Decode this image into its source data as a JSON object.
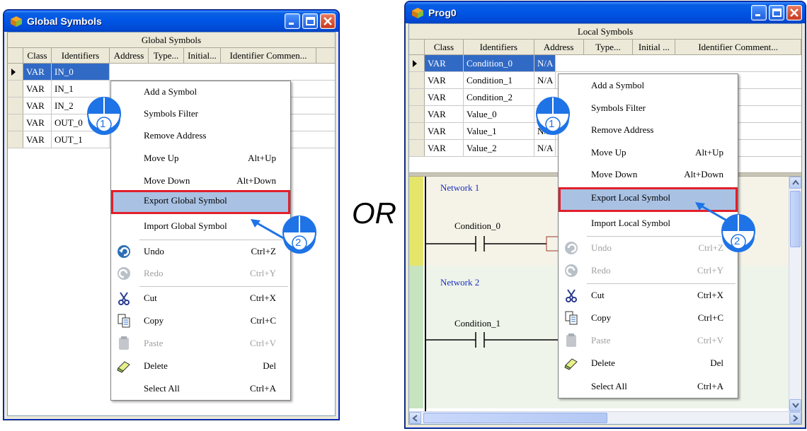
{
  "separator_text": "OR",
  "left_window": {
    "title": "Global Symbols",
    "table_caption": "Global Symbols",
    "columns": [
      "Class",
      "Identifiers",
      "Address",
      "Type...",
      "Initial...",
      "Identifier Commen..."
    ],
    "rows": [
      {
        "class": "VAR",
        "identifier": "IN_0"
      },
      {
        "class": "VAR",
        "identifier": "IN_1"
      },
      {
        "class": "VAR",
        "identifier": "IN_2"
      },
      {
        "class": "VAR",
        "identifier": "OUT_0"
      },
      {
        "class": "VAR",
        "identifier": "OUT_1"
      }
    ],
    "menu": {
      "items": [
        {
          "label": "Add a Symbol",
          "shortcut": ""
        },
        {
          "label": "Symbols Filter",
          "shortcut": ""
        },
        {
          "label": "Remove Address",
          "shortcut": ""
        },
        {
          "label": "Move Up",
          "shortcut": "Alt+Up"
        },
        {
          "label": "Move Down",
          "shortcut": "Alt+Down"
        },
        {
          "label": "Export Global Symbol",
          "shortcut": ""
        },
        {
          "label": "Import Global Symbol",
          "shortcut": ""
        },
        {
          "label": "Undo",
          "shortcut": "Ctrl+Z"
        },
        {
          "label": "Redo",
          "shortcut": "Ctrl+Y"
        },
        {
          "label": "Cut",
          "shortcut": "Ctrl+X"
        },
        {
          "label": "Copy",
          "shortcut": "Ctrl+C"
        },
        {
          "label": "Paste",
          "shortcut": "Ctrl+V"
        },
        {
          "label": "Delete",
          "shortcut": "Del"
        },
        {
          "label": "Select All",
          "shortcut": "Ctrl+A"
        }
      ]
    }
  },
  "right_window": {
    "title": "Prog0",
    "table_caption": "Local Symbols",
    "columns": [
      "Class",
      "Identifiers",
      "Address",
      "Type...",
      "Initial ...",
      "Identifier Comment..."
    ],
    "rows": [
      {
        "class": "VAR",
        "identifier": "Condition_0",
        "address": "N/A"
      },
      {
        "class": "VAR",
        "identifier": "Condition_1",
        "address": "N/A"
      },
      {
        "class": "VAR",
        "identifier": "Condition_2",
        "address": ""
      },
      {
        "class": "VAR",
        "identifier": "Value_0",
        "address": ""
      },
      {
        "class": "VAR",
        "identifier": "Value_1",
        "address": "N/A"
      },
      {
        "class": "VAR",
        "identifier": "Value_2",
        "address": "N/A"
      }
    ],
    "networks": [
      {
        "label": "Network 1",
        "contact": "Condition_0"
      },
      {
        "label": "Network 2",
        "contact": "Condition_1"
      }
    ],
    "menu": {
      "items": [
        {
          "label": "Add a Symbol",
          "shortcut": ""
        },
        {
          "label": "Symbols Filter",
          "shortcut": ""
        },
        {
          "label": "Remove Address",
          "shortcut": ""
        },
        {
          "label": "Move Up",
          "shortcut": "Alt+Up"
        },
        {
          "label": "Move Down",
          "shortcut": "Alt+Down"
        },
        {
          "label": "Export Local Symbol",
          "shortcut": ""
        },
        {
          "label": "Import Local Symbol",
          "shortcut": ""
        },
        {
          "label": "Undo",
          "shortcut": "Ctrl+Z"
        },
        {
          "label": "Redo",
          "shortcut": "Ctrl+Y"
        },
        {
          "label": "Cut",
          "shortcut": "Ctrl+X"
        },
        {
          "label": "Copy",
          "shortcut": "Ctrl+C"
        },
        {
          "label": "Paste",
          "shortcut": "Ctrl+V"
        },
        {
          "label": "Delete",
          "shortcut": "Del"
        },
        {
          "label": "Select All",
          "shortcut": "Ctrl+A"
        }
      ]
    }
  },
  "step_badges": [
    "1",
    "2"
  ],
  "colors": {
    "highlight_frame": "#e2202b",
    "selection": "#316ac5",
    "titlebar": "#0055e5",
    "network_label": "#1a2ebd"
  }
}
